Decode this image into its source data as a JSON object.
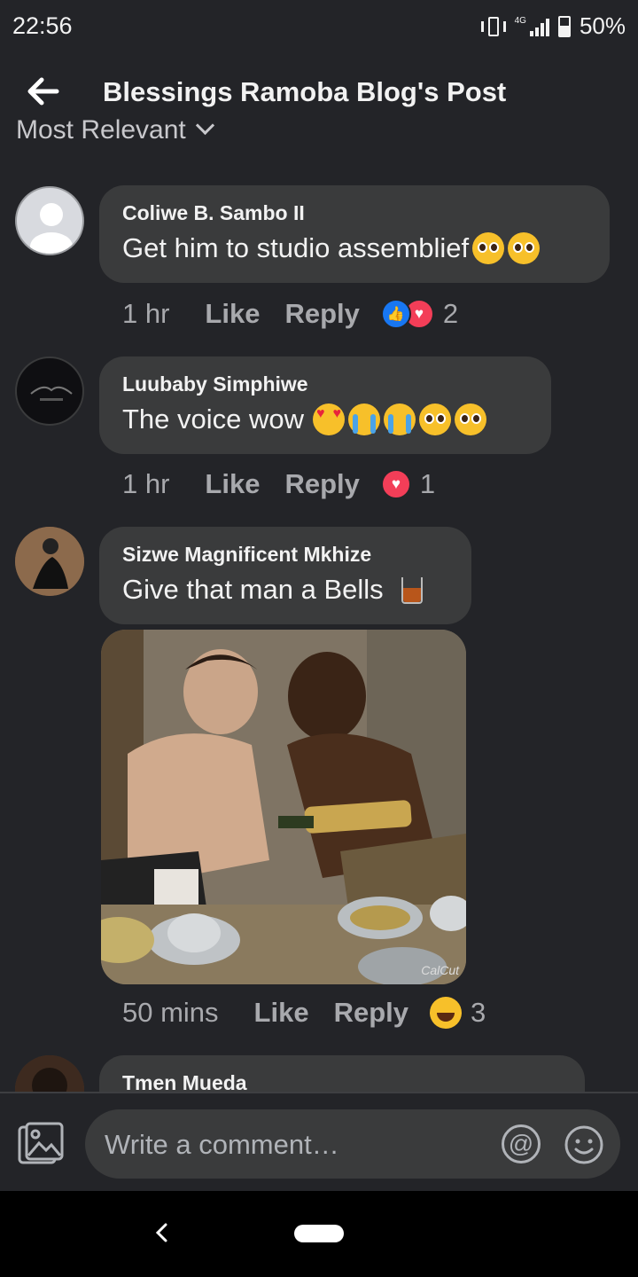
{
  "status_bar": {
    "time": "22:56",
    "network": "4G",
    "battery": "50%"
  },
  "header": {
    "title": "Blessings Ramoba Blog's Post"
  },
  "sort": {
    "label": "Most Relevant"
  },
  "comments": [
    {
      "author": "Coliwe B. Sambo II",
      "text": "Get him to studio assemblief",
      "emojis": [
        "pleading-face",
        "pleading-face"
      ],
      "time": "1 hr",
      "like_label": "Like",
      "reply_label": "Reply",
      "reactions": [
        "like",
        "love"
      ],
      "reaction_count": "2"
    },
    {
      "author": "Luubaby Simphiwe",
      "text": "The voice wow",
      "emojis": [
        "heart-eyes",
        "crying-face",
        "crying-face",
        "pleading-face",
        "pleading-face"
      ],
      "time": "1 hr",
      "like_label": "Like",
      "reply_label": "Reply",
      "reactions": [
        "love"
      ],
      "reaction_count": "1"
    },
    {
      "author": "Sizwe Magnificent Mkhize",
      "text": "Give that man a Bells",
      "emojis": [
        "whisky-glass"
      ],
      "image_watermark": "CalCut",
      "time": "50 mins",
      "like_label": "Like",
      "reply_label": "Reply",
      "reactions": [
        "laughing"
      ],
      "reaction_count": "3"
    },
    {
      "author": "Tmen Mueda"
    }
  ],
  "composer": {
    "placeholder": "Write a comment…"
  },
  "colors": {
    "background": "#232428",
    "bubble": "#3a3b3c",
    "like_blue": "#1877f2",
    "love_red": "#f33e58"
  }
}
